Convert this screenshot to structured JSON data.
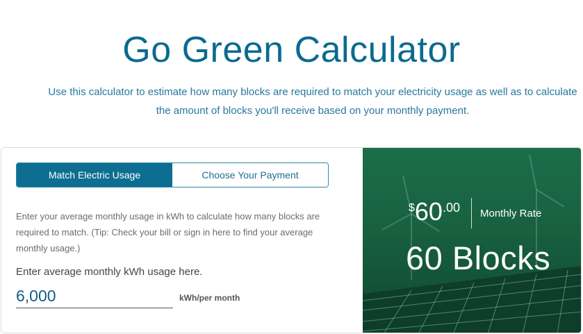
{
  "header": {
    "title": "Go Green Calculator",
    "subtitle": "Use this calculator to estimate how many blocks are required to match your electricity usage as well as to calculate the amount of blocks you'll receive based on your monthly payment."
  },
  "tabs": [
    {
      "label": "Match Electric Usage",
      "active": true
    },
    {
      "label": "Choose Your Payment",
      "active": false
    }
  ],
  "form": {
    "help_text": "Enter your average monthly usage in kWh to calculate how many blocks are required to match. (Tip: Check your bill or sign in here to find your average monthly usage.)",
    "input_label": "Enter average monthly kWh usage here.",
    "kwh_value": "6,000",
    "unit": "kWh/per month"
  },
  "result": {
    "currency": "$",
    "amount": "60",
    "cents": ".00",
    "rate_label": "Monthly Rate",
    "blocks": "60 Blocks"
  },
  "colors": {
    "accent": "#0d6e92",
    "hero_green": "#18603f"
  }
}
